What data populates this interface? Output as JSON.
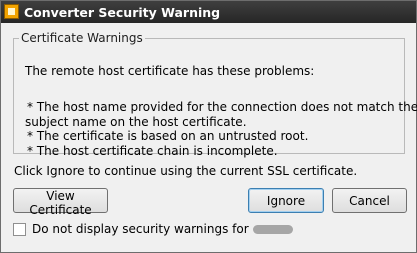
{
  "window": {
    "title": "Converter Security Warning",
    "icon": "warning-app-icon"
  },
  "group": {
    "legend": "Certificate Warnings",
    "lead": "The remote host certificate has these problems:",
    "problems": [
      "* The host name provided for the connection does not match the",
      "subject name on the host certificate.",
      "* The certificate is based on an untrusted root.",
      "* The host certificate chain is incomplete."
    ]
  },
  "hint": "Click Ignore to continue using the current SSL certificate.",
  "buttons": {
    "view_certificate": "View Certificate",
    "ignore": "Ignore",
    "cancel": "Cancel"
  },
  "checkbox": {
    "label": "Do not display security warnings for",
    "checked": false
  }
}
